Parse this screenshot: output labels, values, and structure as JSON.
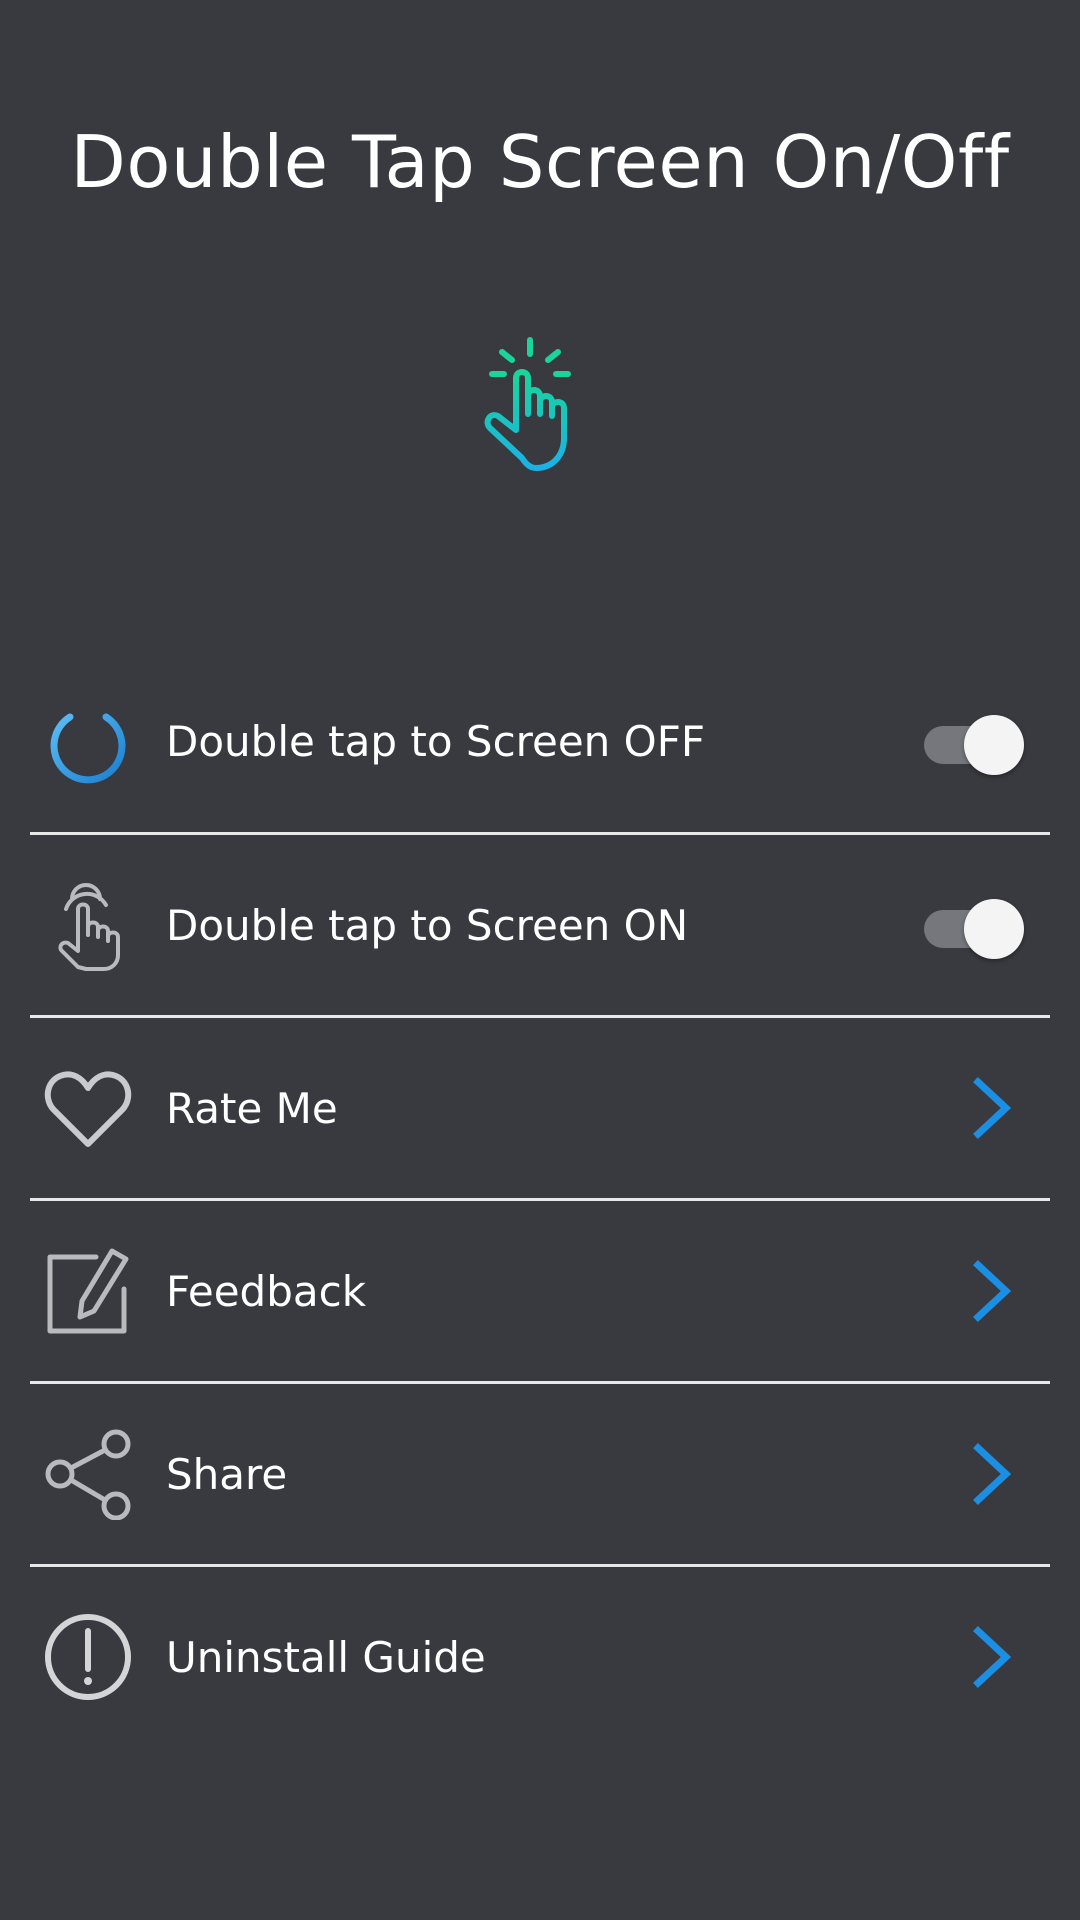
{
  "app": {
    "title": "Double Tap Screen On/Off"
  },
  "colors": {
    "background": "#383a40",
    "accent": "#1a8fe3",
    "hero_green": "#19d59a",
    "hero_blue": "#1ab2e6",
    "divider": "#e8e8e8",
    "toggle_track": "#75777d",
    "toggle_thumb": "#f4f4f4"
  },
  "settings": [
    {
      "label": "Double tap to Screen OFF",
      "icon": "power-icon",
      "toggle": true
    },
    {
      "label": "Double tap to Screen ON",
      "icon": "tap-hand-icon",
      "toggle": true
    }
  ],
  "menu": [
    {
      "label": "Rate Me",
      "icon": "heart-icon"
    },
    {
      "label": "Feedback",
      "icon": "edit-icon"
    },
    {
      "label": "Share",
      "icon": "share-icon"
    },
    {
      "label": "Uninstall Guide",
      "icon": "info-alert-icon"
    }
  ]
}
